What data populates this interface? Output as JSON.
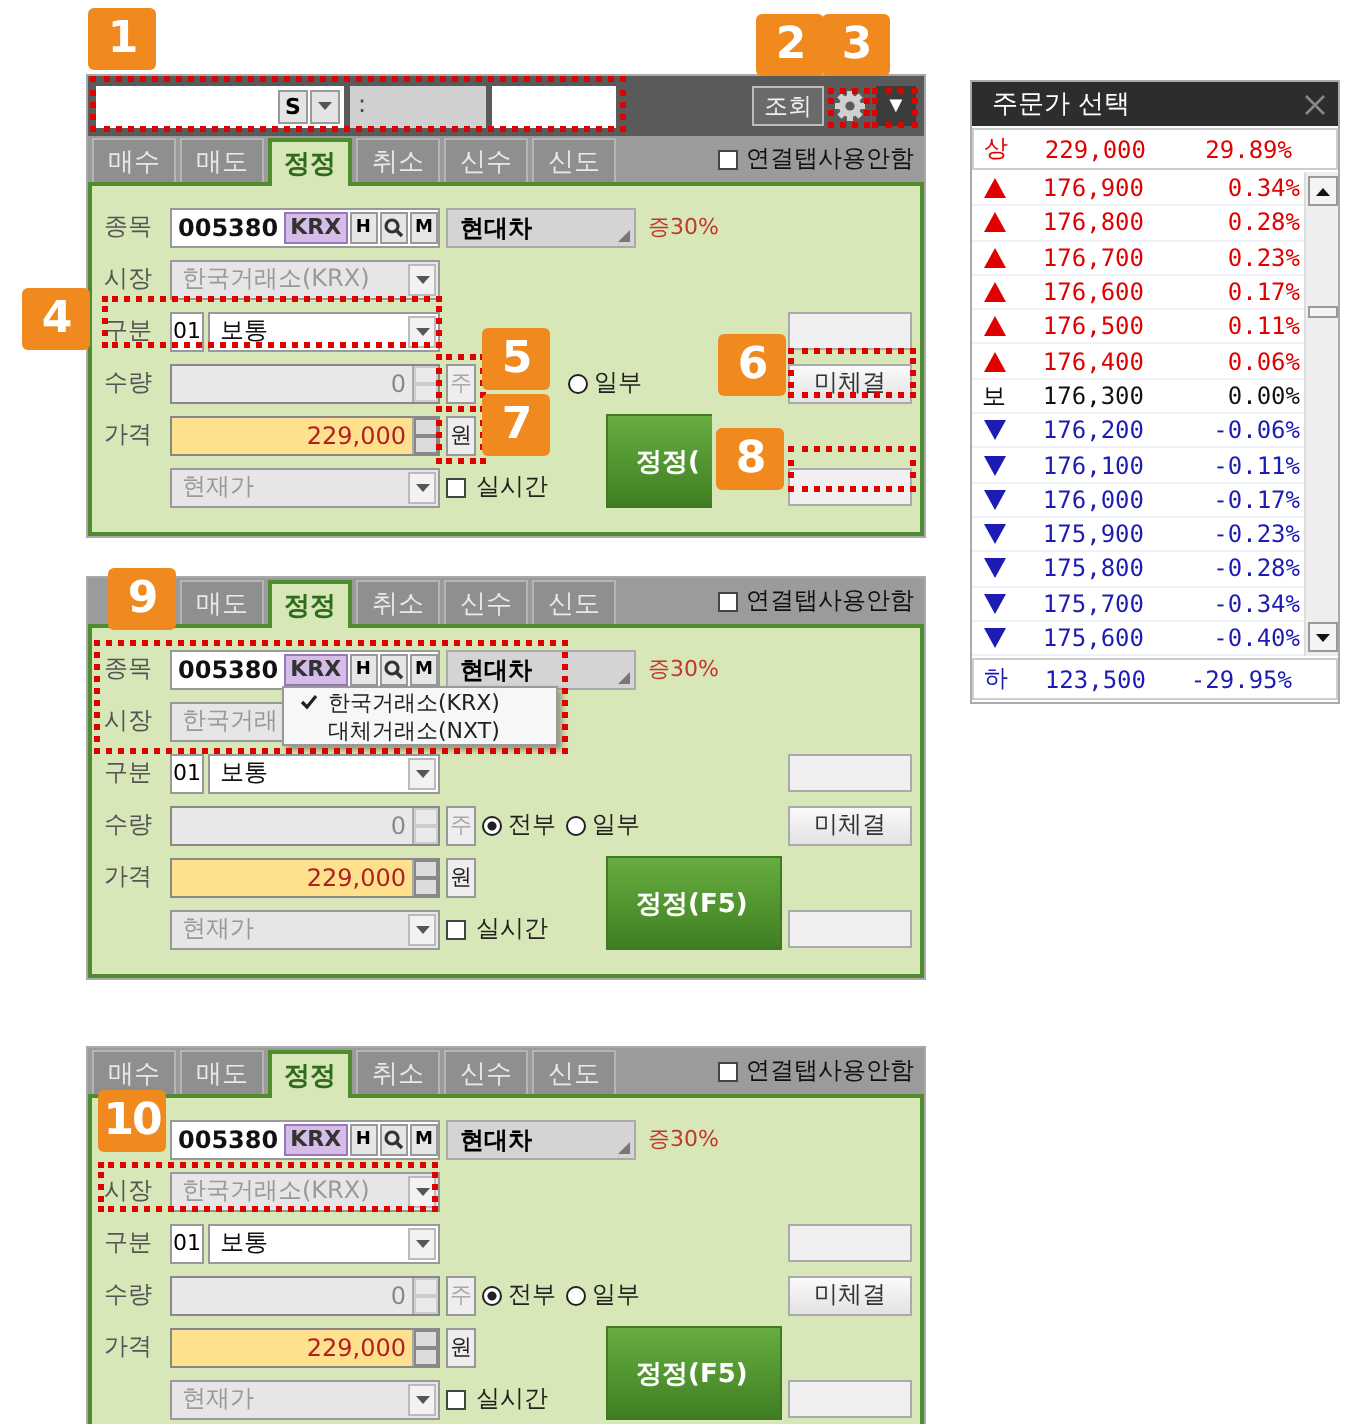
{
  "panels": [
    {
      "annotations": [
        {
          "number": "1"
        },
        {
          "number": "2"
        },
        {
          "number": "3"
        },
        {
          "number": "4"
        },
        {
          "number": "5"
        },
        {
          "number": "6"
        },
        {
          "number": "7"
        },
        {
          "number": "8"
        }
      ],
      "top_bar": {
        "s_button": "S",
        "separator": ":",
        "query_button": "조회",
        "menu_button": "▼"
      },
      "tabs": [
        {
          "kind": "tab",
          "label": "매수",
          "selected": false
        },
        {
          "kind": "tab",
          "label": "매도",
          "selected": false
        },
        {
          "kind": "tab",
          "label": "정정",
          "selected": true
        },
        {
          "kind": "tab",
          "label": "취소",
          "selected": false
        },
        {
          "kind": "tab",
          "label": "신수",
          "selected": false
        },
        {
          "kind": "tab",
          "label": "신도",
          "selected": false
        }
      ],
      "link_option": {
        "label": "연결탭사용안함",
        "checked": false
      },
      "stock": {
        "label": "종목",
        "code": "005380",
        "market_button": "KRX",
        "h_button": "H",
        "m_button": "M",
        "name": "현대차",
        "margin": "증30%"
      },
      "market": {
        "label": "시장",
        "value": "한국거래소(KRX)",
        "disabled": true
      },
      "order_type": {
        "label": "구분",
        "code": "01",
        "value": "보통"
      },
      "quantity": {
        "label": "수량",
        "value": "0",
        "unit": "주",
        "disabled": true
      },
      "radios": [
        {
          "kind": "covered"
        },
        {
          "kind": "radio",
          "label": "일부",
          "selected": false
        }
      ],
      "price": {
        "label": "가격",
        "value": "229,000",
        "unit": "원"
      },
      "price_type": {
        "value": "현재가",
        "disabled": true
      },
      "realtime": {
        "label": "실시간",
        "checked": false
      },
      "unfilled_button": "미체결",
      "submit_button": "정정("
    },
    {
      "annotations": [
        {
          "number": "9"
        }
      ],
      "tabs": [
        {
          "kind": "covered"
        },
        {
          "kind": "tab",
          "label": "매도",
          "selected": false
        },
        {
          "kind": "tab",
          "label": "정정",
          "selected": true
        },
        {
          "kind": "tab",
          "label": "취소",
          "selected": false
        },
        {
          "kind": "tab",
          "label": "신수",
          "selected": false
        },
        {
          "kind": "tab",
          "label": "신도",
          "selected": false
        }
      ],
      "link_option": {
        "label": "연결탭사용안함",
        "checked": false
      },
      "stock": {
        "label": "종목",
        "code": "005380",
        "market_button": "KRX",
        "h_button": "H",
        "m_button": "M",
        "name": "현대차",
        "margin": "증30%"
      },
      "market": {
        "label": "시장",
        "value": "한국거래",
        "disabled": true
      },
      "order_type": {
        "label": "구분",
        "code": "01",
        "value": "보통"
      },
      "quantity": {
        "label": "수량",
        "value": "0",
        "unit": "주",
        "disabled": true
      },
      "radios": [
        {
          "kind": "radio",
          "label": "전부",
          "selected": true
        },
        {
          "kind": "radio",
          "label": "일부",
          "selected": false
        }
      ],
      "price": {
        "label": "가격",
        "value": "229,000",
        "unit": "원"
      },
      "price_type": {
        "value": "현재가",
        "disabled": true
      },
      "realtime": {
        "label": "실시간",
        "checked": false
      },
      "unfilled_button": "미체결",
      "submit_button": "정정(F5)",
      "dropdown": {
        "items": [
          {
            "label": "한국거래소(KRX)",
            "selected": true
          },
          {
            "label": "대체거래소(NXT)",
            "selected": false
          }
        ]
      }
    },
    {
      "annotations": [
        {
          "number": "10"
        }
      ],
      "tabs": [
        {
          "kind": "tab",
          "label": "매수",
          "selected": false
        },
        {
          "kind": "tab",
          "label": "매도",
          "selected": false
        },
        {
          "kind": "tab",
          "label": "정정",
          "selected": true
        },
        {
          "kind": "tab",
          "label": "취소",
          "selected": false
        },
        {
          "kind": "tab",
          "label": "신수",
          "selected": false
        },
        {
          "kind": "tab",
          "label": "신도",
          "selected": false
        }
      ],
      "link_option": {
        "label": "연결탭사용안함",
        "checked": false
      },
      "stock": {
        "code": "005380",
        "market_button": "KRX",
        "h_button": "H",
        "m_button": "M",
        "name": "현대차",
        "margin": "증30%"
      },
      "market": {
        "label": "시장",
        "value": "한국거래소(KRX)",
        "disabled": true
      },
      "order_type": {
        "label": "구분",
        "code": "01",
        "value": "보통"
      },
      "quantity": {
        "label": "수량",
        "value": "0",
        "unit": "주",
        "disabled": true
      },
      "radios": [
        {
          "kind": "radio",
          "label": "전부",
          "selected": true
        },
        {
          "kind": "radio",
          "label": "일부",
          "selected": false
        }
      ],
      "price": {
        "label": "가격",
        "value": "229,000",
        "unit": "원"
      },
      "price_type": {
        "value": "현재가",
        "disabled": true
      },
      "realtime": {
        "label": "실시간",
        "checked": false
      },
      "unfilled_button": "미체결",
      "submit_button": "정정(F5)"
    }
  ],
  "price_selector": {
    "title": "주문가 선택",
    "upper": {
      "label": "상",
      "price": "229,000",
      "rate": "29.89%"
    },
    "rows": [
      {
        "kind": "up",
        "price": "176,900",
        "rate": "0.34%"
      },
      {
        "kind": "up",
        "price": "176,800",
        "rate": "0.28%"
      },
      {
        "kind": "up",
        "price": "176,700",
        "rate": "0.23%"
      },
      {
        "kind": "up",
        "price": "176,600",
        "rate": "0.17%"
      },
      {
        "kind": "up",
        "price": "176,500",
        "rate": "0.11%"
      },
      {
        "kind": "up",
        "price": "176,400",
        "rate": "0.06%"
      },
      {
        "kind": "flat",
        "label": "보",
        "price": "176,300",
        "rate": "0.00%"
      },
      {
        "kind": "down",
        "price": "176,200",
        "rate": "-0.06%"
      },
      {
        "kind": "down",
        "price": "176,100",
        "rate": "-0.11%"
      },
      {
        "kind": "down",
        "price": "176,000",
        "rate": "-0.17%"
      },
      {
        "kind": "down",
        "price": "175,900",
        "rate": "-0.23%"
      },
      {
        "kind": "down",
        "price": "175,800",
        "rate": "-0.28%"
      },
      {
        "kind": "down",
        "price": "175,700",
        "rate": "-0.34%"
      },
      {
        "kind": "down",
        "price": "175,600",
        "rate": "-0.40%"
      }
    ],
    "lower": {
      "label": "하",
      "price": "123,500",
      "rate": "-29.95%"
    }
  }
}
